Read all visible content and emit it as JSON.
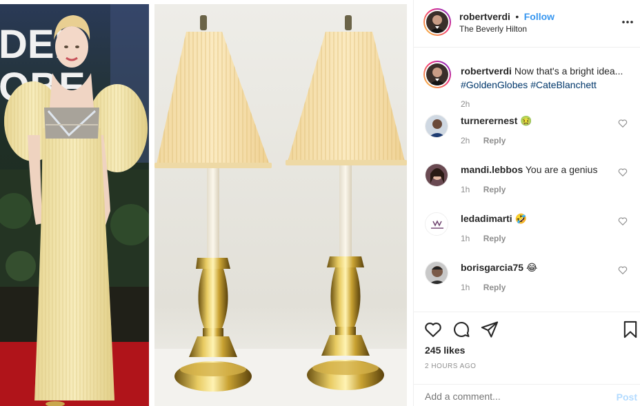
{
  "post": {
    "username": "robertverdi",
    "separator": "•",
    "follow_label": "Follow",
    "location": "The Beverly Hilton",
    "more_icon": "more-options-icon",
    "caption_text": "Now that's a bright idea...",
    "hashtags": [
      "#GoldenGlobes",
      "#CateBlanchett"
    ],
    "caption_time": "2h"
  },
  "comments": [
    {
      "username": "turnerernest",
      "text": "",
      "emoji": "🤢",
      "time": "2h",
      "reply": "Reply"
    },
    {
      "username": "mandi.lebbos",
      "text": "You are a genius",
      "emoji": "",
      "time": "1h",
      "reply": "Reply"
    },
    {
      "username": "ledadimarti",
      "text": "",
      "emoji": "🤣",
      "time": "1h",
      "reply": "Reply"
    },
    {
      "username": "borisgarcia75",
      "text": "",
      "emoji": "😂",
      "time": "1h",
      "reply": "Reply"
    }
  ],
  "footer": {
    "likes": "245 likes",
    "time_ago": "2 HOURS AGO",
    "comment_placeholder": "Add a comment...",
    "post_label": "Post"
  },
  "colors": {
    "follow": "#3897f0",
    "hashtag": "#00376b",
    "muted": "#8e8e8e",
    "post_disabled": "#b3dbff"
  }
}
